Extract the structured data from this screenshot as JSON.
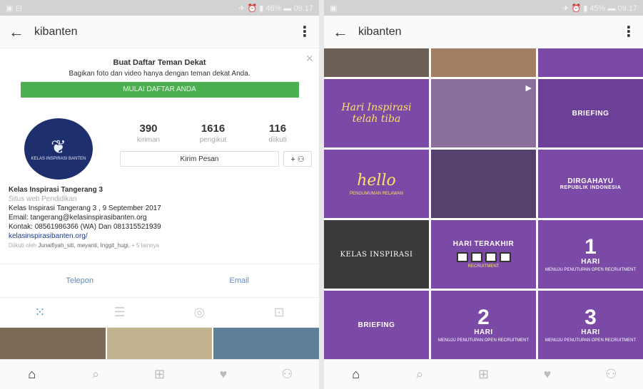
{
  "left": {
    "status": {
      "left_icons": "▣  ⊟",
      "right_icons": "✈ ⏰ ▮ 46% ▬ 09.17"
    },
    "appbar": {
      "back": "←",
      "title": "kibanten",
      "more": "⋮"
    },
    "promo": {
      "title": "Buat Daftar Teman Dekat",
      "description": "Bagikan foto dan video hanya dengan teman dekat Anda.",
      "button": "MULAI DAFTAR ANDA",
      "close": "×"
    },
    "profile": {
      "avatar_text": "KELAS INSPIRASI BANTEN",
      "avatar_mark": "❦",
      "stats": [
        {
          "num": "390",
          "label": "kiriman"
        },
        {
          "num": "1616",
          "label": "pengikut"
        },
        {
          "num": "116",
          "label": "diikuti"
        }
      ],
      "message_button": "Kirim Pesan",
      "add_button": "+ ⚇"
    },
    "bio": {
      "name": "Kelas Inspirasi Tangerang 3",
      "category": "Situs web Pendidikan",
      "line1": "Kelas Inspirasi Tangerang 3 , 9 September 2017",
      "line2": "Email: tangerang@kelasinspirasibanten.org",
      "line3": "Kontak: 08561986366 (WA) Dan 081315521939",
      "link": "kelasinspirasibanten.org/",
      "followed_prefix": "Diikuti oleh",
      "followed_names": "Junaifiyah_siti, meyanti, Inggit_hugi,",
      "followed_suffix": "+ 5 lainnya"
    },
    "contact": {
      "phone": "Telepon",
      "email": "Email"
    },
    "tabs": [
      "⁙",
      "☰",
      "◎",
      "⊡"
    ],
    "nav": [
      "⌂",
      "⌕",
      "⊞",
      "♥",
      "⚇"
    ]
  },
  "right": {
    "status": {
      "left_icons": "▣",
      "right_icons": "✈ ⏰ ▮ 45% ▬ 09.17"
    },
    "appbar": {
      "back": "←",
      "title": "kibanten",
      "more": "⋮"
    },
    "tiles": {
      "inspirasi_line1": "Hari Inspirasi",
      "inspirasi_line2": "telah tiba",
      "briefing1": "BRIEFING",
      "hello": "hello",
      "hello_sub": "PENGUMUMAN RELAWAN",
      "dirgahayu1": "DIRGAHAYU",
      "dirgahayu2": "REPUBLIK INDONESIA",
      "kelas": "KELAS INSPIRASI",
      "hari_terakhir": "HARI TERAKHIR",
      "hari_terakhir_sub": "RECRUITMENT",
      "one": "1",
      "hari": "HARI",
      "menuju": "MENUJU PENUTUPAN OPEN RECRUITMENT",
      "briefing2": "BRIEFING",
      "two": "2",
      "three": "3",
      "video": "▶"
    },
    "nav": [
      "⌂",
      "⌕",
      "⊞",
      "♥",
      "⚇"
    ]
  },
  "colors": {
    "accent_purple": "#7b4aa7",
    "promo_green": "#4cb051",
    "link_blue": "#1d3c8f",
    "tab_blue": "#3f8fd8"
  }
}
